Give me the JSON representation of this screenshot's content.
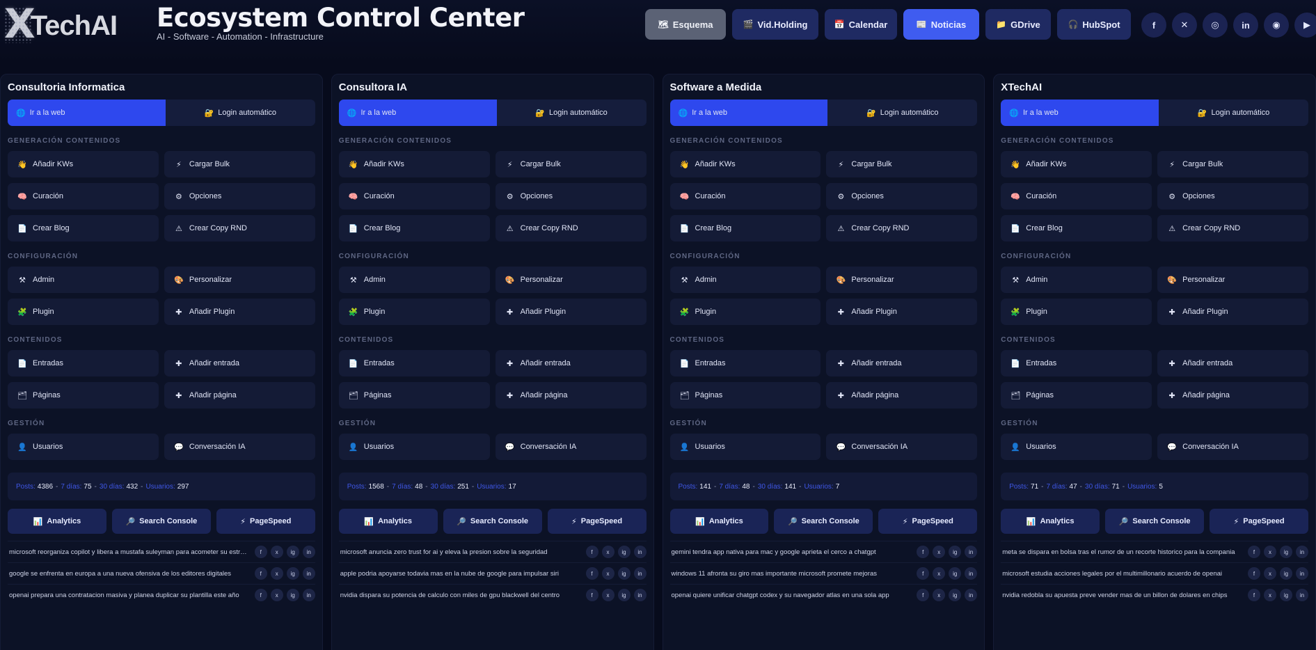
{
  "header": {
    "logo_x": "X",
    "logo_word": "TechAI",
    "title": "Ecosystem Control Center",
    "subtitle": "AI - Software - Automation - Infrastructure"
  },
  "nav": [
    {
      "label": "Esquema",
      "icon": "diagram-icon",
      "glyph": "🗺",
      "style": "gray",
      "width": 116
    },
    {
      "label": "Vid.Holding",
      "icon": "video-icon",
      "glyph": "🎬",
      "style": "dark",
      "width": 124
    },
    {
      "label": "Calendar",
      "icon": "calendar-icon",
      "glyph": "📅",
      "style": "dark",
      "width": 104
    },
    {
      "label": "Noticias",
      "icon": "news-icon",
      "glyph": "📰",
      "style": "active",
      "width": 109
    },
    {
      "label": "GDrive",
      "icon": "folder-icon",
      "glyph": "📁",
      "style": "dark",
      "width": 94
    },
    {
      "label": "HubSpot",
      "icon": "headphones-icon",
      "glyph": "🎧",
      "style": "dark",
      "width": 106
    }
  ],
  "social": [
    {
      "name": "facebook-icon",
      "glyph": "f"
    },
    {
      "name": "x-twitter-icon",
      "glyph": "✕"
    },
    {
      "name": "instagram-icon",
      "glyph": "◎"
    },
    {
      "name": "linkedin-icon",
      "glyph": "in"
    },
    {
      "name": "chat-icon",
      "glyph": "◉"
    },
    {
      "name": "youtube-icon",
      "glyph": "▶"
    }
  ],
  "common": {
    "go_web": "Ir a la web",
    "auto_login": "Login automático",
    "sections": {
      "content_gen": "GENERACIÓN CONTENIDOS",
      "config": "CONFIGURACIÓN",
      "contents": "CONTENIDOS",
      "management": "GESTIÓN"
    },
    "content_gen_buttons": [
      {
        "label": "Añadir KWs",
        "icon": "hand-icon",
        "glyph": "👋"
      },
      {
        "label": "Cargar Bulk",
        "icon": "bolt-icon",
        "glyph": "⚡"
      },
      {
        "label": "Curación",
        "icon": "brain-icon",
        "glyph": "🧠"
      },
      {
        "label": "Opciones",
        "icon": "gear-icon",
        "glyph": "⚙"
      },
      {
        "label": "Crear Blog",
        "icon": "document-icon",
        "glyph": "📄"
      },
      {
        "label": "Crear Copy RND",
        "icon": "warning-icon",
        "glyph": "⚠"
      }
    ],
    "config_buttons": [
      {
        "label": "Admin",
        "icon": "tools-icon",
        "glyph": "⚒"
      },
      {
        "label": "Personalizar",
        "icon": "palette-icon",
        "glyph": "🎨"
      },
      {
        "label": "Plugin",
        "icon": "plugin-icon",
        "glyph": "🧩"
      },
      {
        "label": "Añadir Plugin",
        "icon": "plus-icon",
        "glyph": "✚"
      }
    ],
    "contents_buttons": [
      {
        "label": "Entradas",
        "icon": "document-icon",
        "glyph": "📄"
      },
      {
        "label": "Añadir entrada",
        "icon": "plus-icon",
        "glyph": "✚"
      },
      {
        "label": "Páginas",
        "icon": "pages-icon",
        "glyph": "🗂"
      },
      {
        "label": "Añadir página",
        "icon": "plus-icon",
        "glyph": "✚"
      }
    ],
    "management_buttons": [
      {
        "label": "Usuarios",
        "icon": "user-icon",
        "glyph": "👤"
      },
      {
        "label": "Conversación IA",
        "icon": "speech-bubble-icon",
        "glyph": "💬"
      }
    ],
    "stat_labels": {
      "posts": "Posts:",
      "d7": "7 días:",
      "d30": "30 días:",
      "users": "Usuarios:"
    },
    "tools": [
      {
        "label": "Analytics",
        "icon": "chart-icon",
        "glyph": "📊"
      },
      {
        "label": "Search Console",
        "icon": "magnifier-icon",
        "glyph": "🔎"
      },
      {
        "label": "PageSpeed",
        "icon": "bolt-icon",
        "glyph": "⚡"
      }
    ],
    "share": [
      "f",
      "x",
      "ig",
      "in"
    ]
  },
  "sites": [
    {
      "name": "Consultoria Informatica",
      "stats": {
        "posts": "4386",
        "d7": "75",
        "d30": "432",
        "users": "297"
      },
      "news": [
        "microsoft reorganiza copilot y libera a mustafa suleyman para acometer su estrategia",
        "google se enfrenta en europa a una nueva ofensiva de los editores digitales",
        "openai prepara una contratacion masiva y planea duplicar su plantilla este año"
      ]
    },
    {
      "name": "Consultora IA",
      "stats": {
        "posts": "1568",
        "d7": "48",
        "d30": "251",
        "users": "17"
      },
      "news": [
        "microsoft anuncia zero trust for ai y eleva la presion sobre la seguridad",
        "apple podria apoyarse todavia mas en la nube de google para impulsar siri",
        "nvidia dispara su potencia de calculo con miles de gpu blackwell del centro"
      ]
    },
    {
      "name": "Software a Medida",
      "stats": {
        "posts": "141",
        "d7": "48",
        "d30": "141",
        "users": "7"
      },
      "news": [
        "gemini tendra app nativa para mac y google aprieta el cerco a chatgpt",
        "windows 11 afronta su giro mas importante microsoft promete mejoras",
        "openai quiere unificar chatgpt codex y su navegador atlas en una sola app"
      ]
    },
    {
      "name": "XTechAI",
      "stats": {
        "posts": "71",
        "d7": "47",
        "d30": "71",
        "users": "5"
      },
      "news": [
        "meta se dispara en bolsa tras el rumor de un recorte historico para la compania",
        "microsoft estudia acciones legales por el multimillonario acuerdo de openai",
        "nvidia redobla su apuesta preve vender mas de un billon de dolares en chips"
      ]
    }
  ]
}
